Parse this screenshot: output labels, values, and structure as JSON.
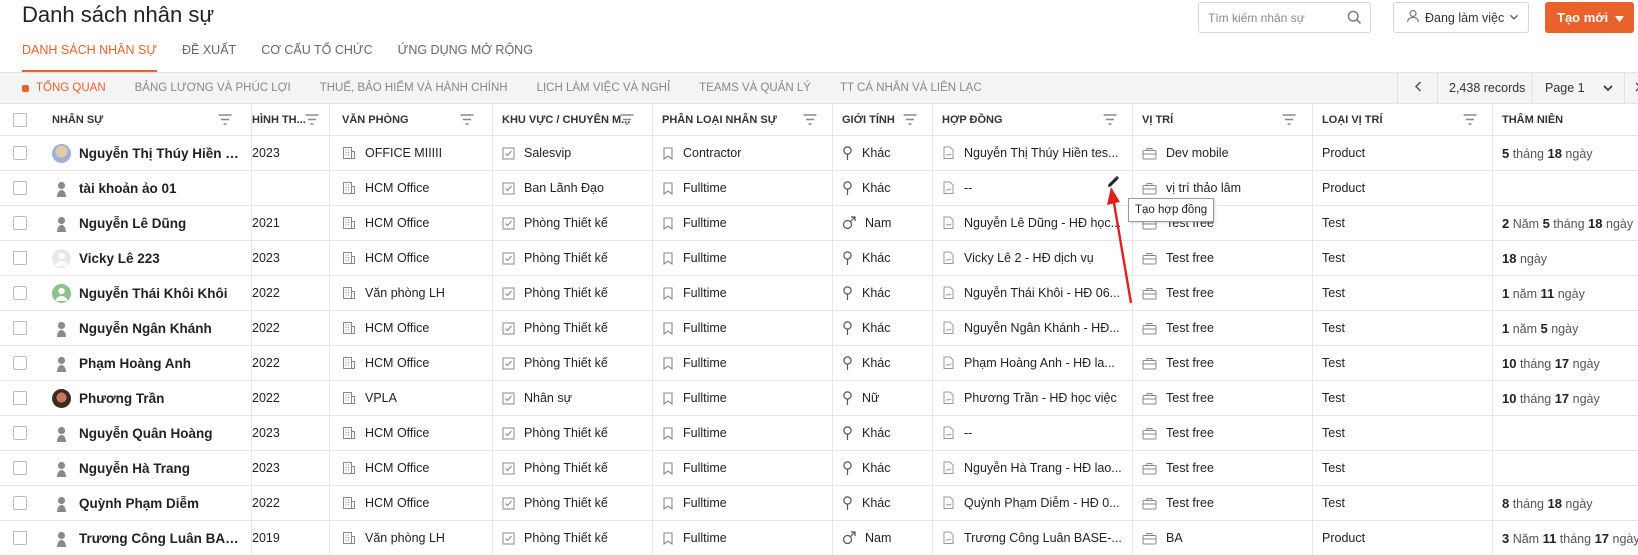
{
  "header": {
    "title": "Danh sách nhân sự",
    "search_placeholder": "Tìm kiếm nhân sự",
    "status_label": "Đang làm việc",
    "create_label": "Tạo mới"
  },
  "tabs": [
    {
      "label": "DANH SÁCH NHÂN SỰ",
      "active": true
    },
    {
      "label": "ĐỀ XUẤT",
      "active": false
    },
    {
      "label": "CƠ CẤU TỔ CHỨC",
      "active": false
    },
    {
      "label": "ỨNG DỤNG MỞ RỘNG",
      "active": false
    }
  ],
  "subtabs": [
    {
      "label": "TỔNG QUAN",
      "active": true
    },
    {
      "label": "BẢNG LƯƠNG VÀ PHÚC LỢI",
      "active": false
    },
    {
      "label": "THUẾ, BẢO HIỂM VÀ HÀNH CHÍNH",
      "active": false
    },
    {
      "label": "LỊCH LÀM VIỆC VÀ NGHỈ",
      "active": false
    },
    {
      "label": "TEAMS VÀ QUẢN LÝ",
      "active": false
    },
    {
      "label": "TT CÁ NHÂN VÀ LIÊN LẠC",
      "active": false
    }
  ],
  "pager": {
    "records": "2,438 records",
    "page": "Page 1"
  },
  "columns": {
    "employee": "NHÂN SỰ",
    "form": "HÌNH TH...",
    "office": "VĂN PHÒNG",
    "area": "KHU VỰC / CHUYÊN M...",
    "category": "PHÂN LOẠI NHÂN SỰ",
    "gender": "GIỚI TÍNH",
    "contract": "HỢP ĐỒNG",
    "position": "VỊ TRÍ",
    "position_type": "LOẠI VỊ TRÍ",
    "tenure": "THÂM NIÊN"
  },
  "rows": [
    {
      "name": "Nguyễn Thị Thúy Hiền te...",
      "avatar": "photo1",
      "year": "2023",
      "office": "OFFICE MIIIII",
      "area": "Salesvip",
      "category": "Contractor",
      "gender": "Khác",
      "gender_icon": "female",
      "contract": "Nguyễn Thị Thúy Hiền tes...",
      "position": "Dev mobile",
      "position_type": "Product",
      "tenure": [
        {
          "n": "5",
          "u": " tháng "
        },
        {
          "n": "18",
          "u": " ngày"
        }
      ]
    },
    {
      "name": "tài khoản ảo 01",
      "avatar": "gray",
      "year": "",
      "office": "HCM Office",
      "area": "Ban Lãnh Đạo",
      "category": "Fulltime",
      "gender": "Khác",
      "gender_icon": "female",
      "contract": "--",
      "position": "vị trí thảo lâm",
      "position_type": "Product",
      "tenure": []
    },
    {
      "name": "Nguyễn Lê Dũng",
      "avatar": "gray",
      "year": "2021",
      "office": "HCM Office",
      "area": "Phòng Thiết kế",
      "category": "Fulltime",
      "gender": "Nam",
      "gender_icon": "male",
      "contract": "Nguyễn Lê Dũng - HĐ học...",
      "position": "Test free",
      "position_type": "Test",
      "tenure": [
        {
          "n": "2",
          "u": " Năm "
        },
        {
          "n": "5",
          "u": " tháng "
        },
        {
          "n": "18",
          "u": " ngày"
        }
      ]
    },
    {
      "name": "Vicky Lê 223",
      "avatar": "light",
      "year": "2023",
      "office": "HCM Office",
      "area": "Phòng Thiết kế",
      "category": "Fulltime",
      "gender": "Khác",
      "gender_icon": "female",
      "contract": "Vicky Lê 2 - HĐ dịch vụ",
      "position": "Test free",
      "position_type": "Test",
      "tenure": [
        {
          "n": "18",
          "u": " ngày"
        }
      ]
    },
    {
      "name": "Nguyễn Thái Khôi Khôi",
      "avatar": "green",
      "year": "2022",
      "office": "Văn phòng LH",
      "area": "Phòng Thiết kế",
      "category": "Fulltime",
      "gender": "Khác",
      "gender_icon": "female",
      "contract": "Nguyễn Thái Khôi - HĐ 06...",
      "position": "Test free",
      "position_type": "Test",
      "tenure": [
        {
          "n": "1",
          "u": " năm "
        },
        {
          "n": "11",
          "u": " ngày"
        }
      ]
    },
    {
      "name": "Nguyễn Ngân Khánh",
      "avatar": "gray",
      "year": "2022",
      "office": "HCM Office",
      "area": "Phòng Thiết kế",
      "category": "Fulltime",
      "gender": "Khác",
      "gender_icon": "female",
      "contract": "Nguyễn Ngân Khánh - HĐ...",
      "position": "Test free",
      "position_type": "Test",
      "tenure": [
        {
          "n": "1",
          "u": " năm "
        },
        {
          "n": "5",
          "u": " ngày"
        }
      ]
    },
    {
      "name": "Phạm Hoàng Anh",
      "avatar": "gray",
      "year": "2022",
      "office": "HCM Office",
      "area": "Phòng Thiết kế",
      "category": "Fulltime",
      "gender": "Khác",
      "gender_icon": "female",
      "contract": "Phạm Hoàng Anh - HĐ la...",
      "position": "Test free",
      "position_type": "Test",
      "tenure": [
        {
          "n": "10",
          "u": " tháng "
        },
        {
          "n": "17",
          "u": " ngày"
        }
      ]
    },
    {
      "name": "Phương Trần",
      "avatar": "photo2",
      "year": "2022",
      "office": "VPLA",
      "area": "Nhân sự",
      "category": "Fulltime",
      "gender": "Nữ",
      "gender_icon": "female",
      "contract": "Phương Trần - HĐ học việc",
      "position": "Test free",
      "position_type": "Test",
      "tenure": [
        {
          "n": "10",
          "u": " tháng "
        },
        {
          "n": "17",
          "u": " ngày"
        }
      ]
    },
    {
      "name": "Nguyễn Quân Hoàng",
      "avatar": "gray",
      "year": "2023",
      "office": "HCM Office",
      "area": "Phòng Thiết kế",
      "category": "Fulltime",
      "gender": "Khác",
      "gender_icon": "female",
      "contract": "--",
      "position": "Test free",
      "position_type": "Test",
      "tenure": []
    },
    {
      "name": "Nguyễn Hà Trang",
      "avatar": "gray",
      "year": "2023",
      "office": "HCM Office",
      "area": "Phòng Thiết kế",
      "category": "Fulltime",
      "gender": "Khác",
      "gender_icon": "female",
      "contract": "Nguyễn Hà Trang - HĐ lao...",
      "position": "Test free",
      "position_type": "Test",
      "tenure": []
    },
    {
      "name": "Quỳnh Phạm Diễm",
      "avatar": "gray",
      "year": "2022",
      "office": "HCM Office",
      "area": "Phòng Thiết kế",
      "category": "Fulltime",
      "gender": "Khác",
      "gender_icon": "female",
      "contract": "Quỳnh Phạm Diễm - HĐ 0...",
      "position": "Test free",
      "position_type": "Test",
      "tenure": [
        {
          "n": "8",
          "u": " tháng "
        },
        {
          "n": "18",
          "u": " ngày"
        }
      ]
    },
    {
      "name": "Trương Công Luân BASE...",
      "avatar": "gray",
      "year": "2019",
      "office": "Văn phòng LH",
      "area": "Phòng Thiết kế",
      "category": "Fulltime",
      "gender": "Nam",
      "gender_icon": "male",
      "contract": "Trương Công Luân BASE-...",
      "position": "BA",
      "position_type": "Product",
      "tenure": [
        {
          "n": "3",
          "u": " Năm "
        },
        {
          "n": "11",
          "u": " tháng "
        },
        {
          "n": "17",
          "u": " ngày"
        }
      ]
    }
  ],
  "tooltip": "Tạo hợp đồng",
  "colors": {
    "accent": "#e9612b",
    "arrow": "#e02020"
  }
}
